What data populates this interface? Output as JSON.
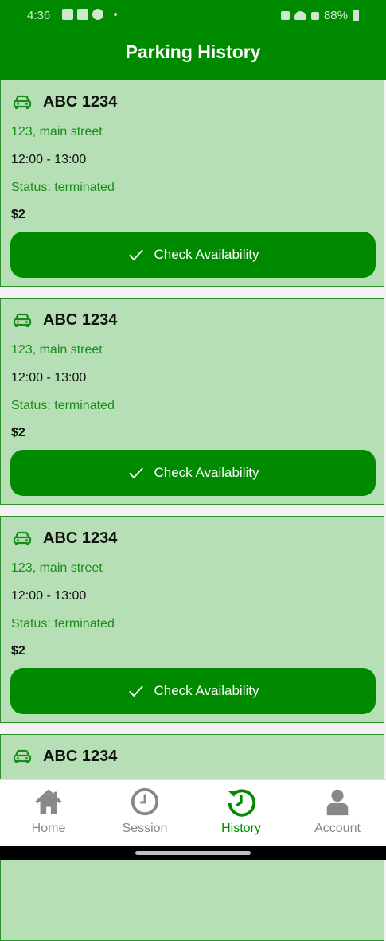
{
  "status_bar": {
    "time": "4:36",
    "battery": "88%"
  },
  "header": {
    "title": "Parking History"
  },
  "cards": [
    {
      "plate": "ABC 1234",
      "address": "123, main street",
      "time": "12:00 - 13:00",
      "status": "Status: terminated",
      "price": "$2",
      "button": "Check Availability"
    },
    {
      "plate": "ABC 1234",
      "address": "123, main street",
      "time": "12:00 - 13:00",
      "status": "Status: terminated",
      "price": "$2",
      "button": "Check Availability"
    },
    {
      "plate": "ABC 1234",
      "address": "123, main street",
      "time": "12:00 - 13:00",
      "status": "Status: terminated",
      "price": "$2",
      "button": "Check Availability"
    },
    {
      "plate": "ABC 1234"
    }
  ],
  "nav": [
    {
      "label": "Home",
      "icon": "home-icon"
    },
    {
      "label": "Session",
      "icon": "clock-icon"
    },
    {
      "label": "History",
      "icon": "history-icon",
      "active": true
    },
    {
      "label": "Account",
      "icon": "account-icon"
    }
  ],
  "colors": {
    "primary": "#008a00",
    "card": "#b6dfb6",
    "accent_text": "#1a8c1a"
  }
}
